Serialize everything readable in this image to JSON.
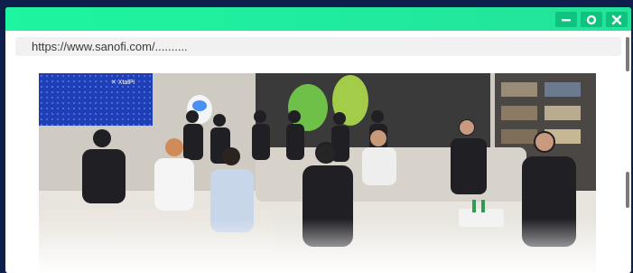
{
  "browser": {
    "url": "https://www.sanofi.com/..........",
    "titlebar_color": "#1ef5a0",
    "controls": [
      {
        "name": "minimize-icon"
      },
      {
        "name": "maximize-icon"
      },
      {
        "name": "close-icon"
      }
    ]
  },
  "content": {
    "photo_subject": "meeting-room-photo",
    "logo_text": "XtalPi"
  }
}
